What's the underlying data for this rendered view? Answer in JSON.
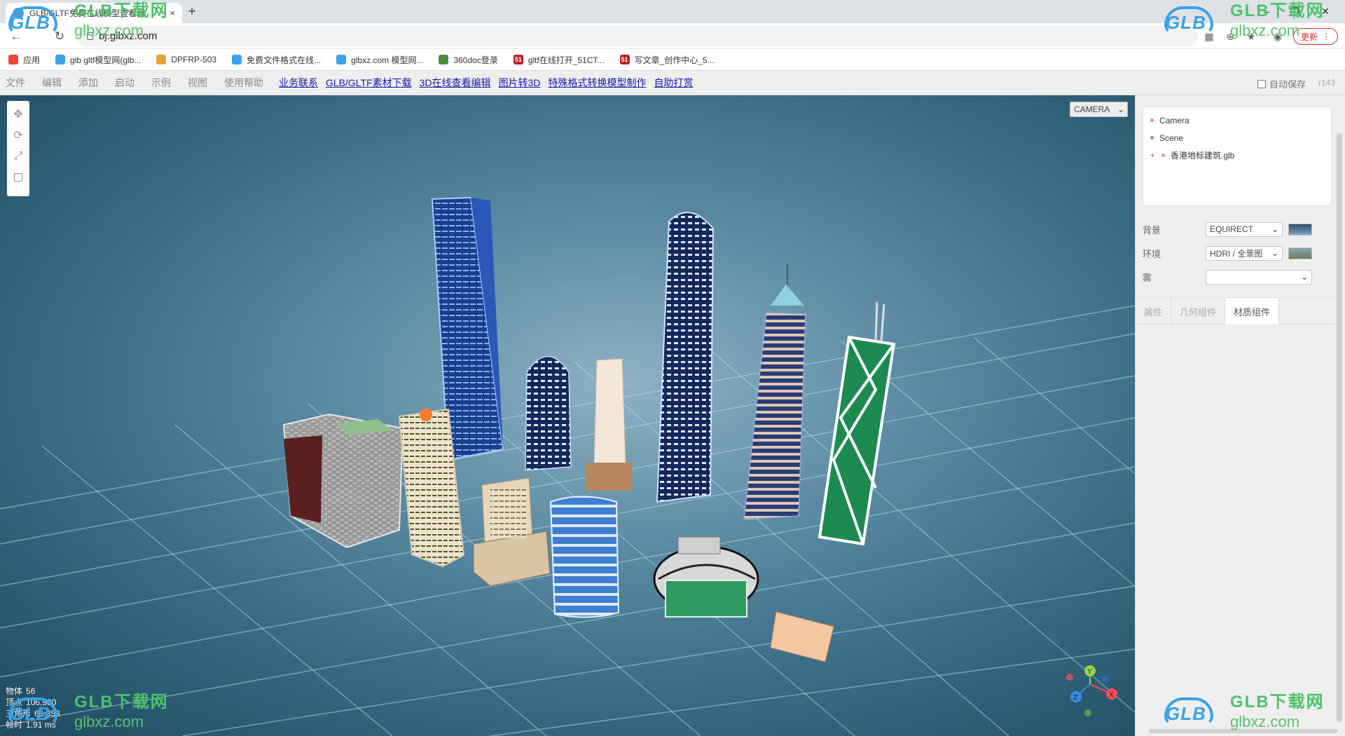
{
  "browser": {
    "tab_title": "GLB/GLTF免费在线模型查看器",
    "tab_close": "×",
    "new_tab": "+",
    "url": "bj.glbxz.com",
    "update_label": "更新",
    "window_controls": {
      "minimize": "–",
      "maximize": "❐",
      "close": "✕"
    },
    "nav": {
      "back": "←",
      "reload": "↻"
    }
  },
  "bookmarks": [
    {
      "label": "应用",
      "icon": "apps-grid-icon",
      "color": "#e8453c"
    },
    {
      "label": "glb gltf模型网(glb...",
      "icon": "cloud-icon",
      "color": "#3aa2e8"
    },
    {
      "label": "DPFRP-503",
      "icon": "cube-icon",
      "color": "#e8a13c"
    },
    {
      "label": "免费文件格式在线...",
      "icon": "cloud-icon",
      "color": "#3aa2e8"
    },
    {
      "label": "glbxz.com 模型网...",
      "icon": "cloud-icon",
      "color": "#3aa2e8"
    },
    {
      "label": "360doc登录",
      "icon": "doc-icon",
      "color": "#4a8f3c"
    },
    {
      "label": "gltf在线打开_51CT...",
      "icon": "51-icon",
      "color": "#b8202a",
      "glyph": "51"
    },
    {
      "label": "写文章_创作中心_5...",
      "icon": "51-icon",
      "color": "#b8202a",
      "glyph": "51"
    }
  ],
  "menu": {
    "items": [
      "文件",
      "编辑",
      "添加",
      "启动",
      "示例",
      "视图",
      "使用帮助"
    ],
    "links": [
      "业务联系",
      "GLB/GLTF素材下载",
      "3D在线查看编辑",
      "图片转3D",
      "特殊格式转换模型制作",
      "自助打赏"
    ],
    "autosave_label": "自动保存",
    "revision": "r143"
  },
  "viewport": {
    "camera_select": "CAMERA",
    "stats": [
      {
        "label": "物体",
        "value": "56"
      },
      {
        "label": "顶点",
        "value": "106,980"
      },
      {
        "label": "三角形",
        "value": "66,358"
      },
      {
        "label": "帧时",
        "value": "1.91 ms"
      }
    ],
    "gizmo": {
      "x": "X",
      "y": "Y",
      "z": "Z"
    }
  },
  "sidebar": {
    "outliner": [
      {
        "label": "Camera",
        "dot": "#d98b8b",
        "indent": 0
      },
      {
        "label": "Scene",
        "dot": "#8b8bd9",
        "indent": 0
      },
      {
        "label": "香港地标建筑.glb",
        "dot": "#d98bd9",
        "indent": 1,
        "expander": "+"
      }
    ],
    "background_label": "背景",
    "background_value": "EQUIRECT",
    "environment_label": "环境",
    "environment_value": "HDRI / 全景图",
    "fog_label": "雾",
    "fog_value": "",
    "tabs": [
      "属性",
      "几何组件",
      "材质组件"
    ],
    "active_tab": 2
  },
  "watermark": {
    "logo": "GLB",
    "title": "GLB下载网",
    "site": "glbxz.com"
  },
  "colors": {
    "accent_link": "#1a1aa6",
    "update_red": "#d93025",
    "watermark_blue": "#3aa2e8",
    "watermark_green": "#4cc26a"
  }
}
